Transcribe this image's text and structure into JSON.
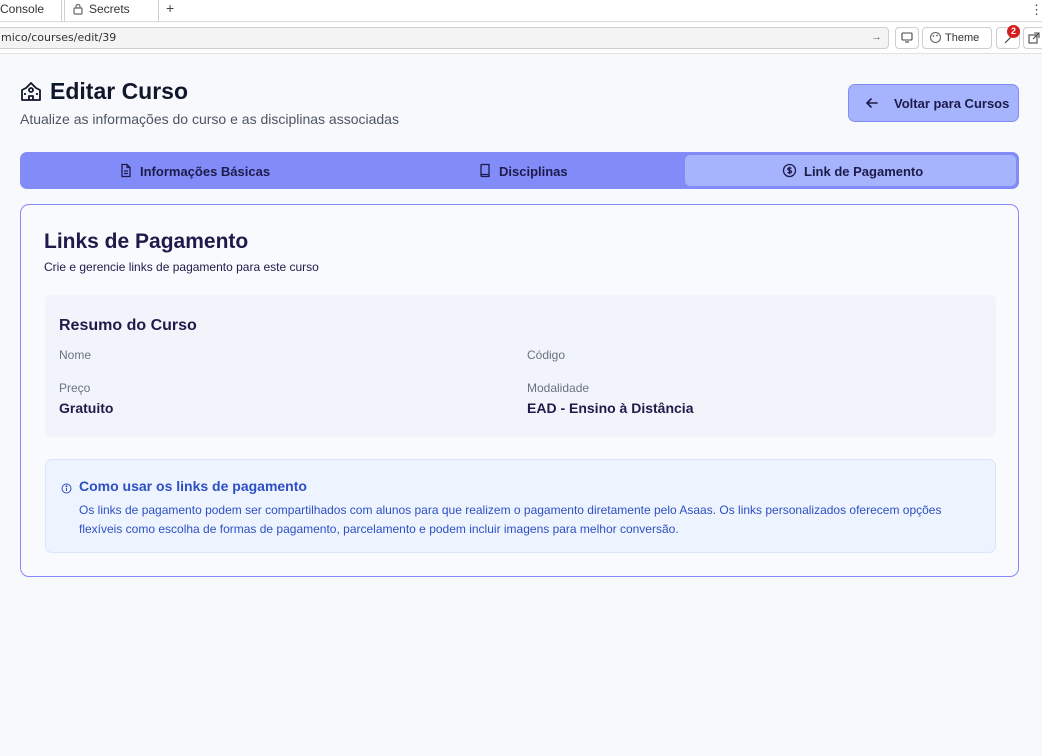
{
  "browser": {
    "tabs": [
      {
        "label": "Console"
      },
      {
        "label": "Secrets"
      }
    ],
    "new_tab_glyph": "+",
    "url": "mico/courses/edit/39",
    "theme_label": "Theme",
    "notification_count": "2"
  },
  "header": {
    "title": "Editar Curso",
    "subtitle": "Atualize as informações do curso e as disciplinas associadas",
    "back_label": "Voltar para Cursos"
  },
  "tabs": [
    {
      "label": "Informações Básicas",
      "icon": "document-icon",
      "active": false
    },
    {
      "label": "Disciplinas",
      "icon": "book-icon",
      "active": false
    },
    {
      "label": "Link de Pagamento",
      "icon": "dollar-icon",
      "active": true
    }
  ],
  "card": {
    "title": "Links de Pagamento",
    "description": "Crie e gerencie links de pagamento para este curso",
    "summary": {
      "title": "Resumo do Curso",
      "fields": [
        {
          "label": "Nome",
          "value": ""
        },
        {
          "label": "Código",
          "value": ""
        },
        {
          "label": "Preço",
          "value": "Gratuito"
        },
        {
          "label": "Modalidade",
          "value": "EAD - Ensino à Distância"
        }
      ]
    },
    "info": {
      "title": "Como usar os links de pagamento",
      "text": "Os links de pagamento podem ser compartilhados com alunos para que realizem o pagamento diretamente pelo Asaas. Os links personalizados oferecem opções flexíveis como escolha de formas de pagamento, parcelamento e podem incluir imagens para melhor conversão."
    }
  },
  "colors": {
    "accent": "#818cf8",
    "accent_light": "#a5b4fc",
    "info_text": "#2d4fc2",
    "badge": "#d41e1e"
  }
}
